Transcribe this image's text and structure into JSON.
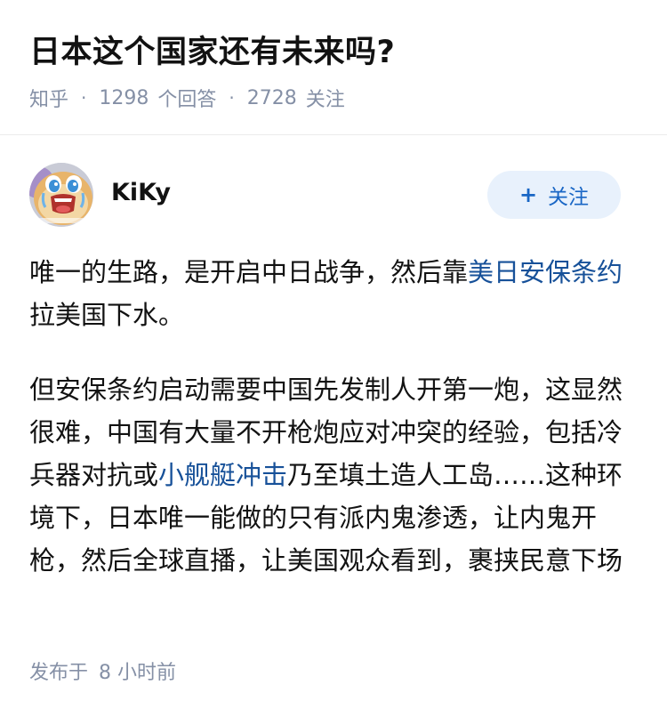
{
  "question": {
    "title": "日本这个国家还有未来吗?"
  },
  "meta": {
    "source": "知乎",
    "answers_count": "1298",
    "answers_label": "个回答",
    "followers_count": "2728",
    "followers_label": "关注"
  },
  "author": {
    "name": "KiKy",
    "avatar_icon": "cartoon-crying-character-avatar",
    "follow_label": "关注"
  },
  "answer": {
    "p1_prefix": "唯一的生路，是开启中日战争，然后靠",
    "p1_link": "美日安保条约",
    "p1_suffix": "拉美国下水。",
    "p2_prefix": "但安保条约启动需要中国先发制人开第一炮，这显然很难，中国有大量不开枪炮应对冲突的经验，包括冷兵器对抗或",
    "p2_link": "小舰艇冲击",
    "p2_suffix": "乃至填土造人工岛……这种环境下，日本唯一能做的只有派内鬼渗透，让内鬼开枪，然后全球直播，让美国观众看到，裹挟民意下场"
  },
  "footer": {
    "publish_label": "发布于",
    "publish_value": "8 小时前"
  },
  "colors": {
    "link": "#175199",
    "meta": "#8590a6",
    "follow_bg": "#e8f1fc",
    "follow_text": "#1966c5"
  }
}
